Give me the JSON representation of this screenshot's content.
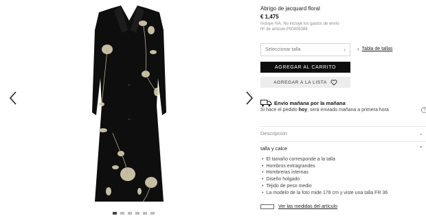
{
  "gallery": {
    "prev_icon": "chevron-left-icon",
    "next_icon": "chevron-right-icon",
    "image": "black jacquard floral coat"
  },
  "product": {
    "name": "Abrigo de jacquard floral",
    "price": "€ 1,475",
    "tax_note": "Incluye IVA. No incluye los gastos de envío",
    "article_number": "Nº de artículo P00405388"
  },
  "size": {
    "placeholder": "Seleccionar talla",
    "guide_label": "Tabla de tallas"
  },
  "buttons": {
    "add_to_cart": "AGREGAR AL CARRITO",
    "add_to_list": "AGREGAR A LA LISTA"
  },
  "shipping": {
    "title": "Envío mañana por la mañana",
    "sub_prefix": "Si hace el pedido ",
    "sub_bold": "hoy",
    "sub_suffix": ", será enviado mañana a primera hora",
    "icon": "truck-icon"
  },
  "accordions": {
    "description": "Descripción",
    "fit": "talla y calce"
  },
  "fit_items": [
    "El tamaño corresponde a la talla",
    "Hombros extragrandes",
    "Hombreras internas",
    "Diseño holgado",
    "Tejido de peso medio",
    "La modelo de la foto mide 178 cm y viste una talla FR 36"
  ],
  "measurements_link": "Ver las medidas del artículo",
  "colors": {
    "primary_button": "#0d0d0d",
    "secondary_button": "#ededed"
  }
}
